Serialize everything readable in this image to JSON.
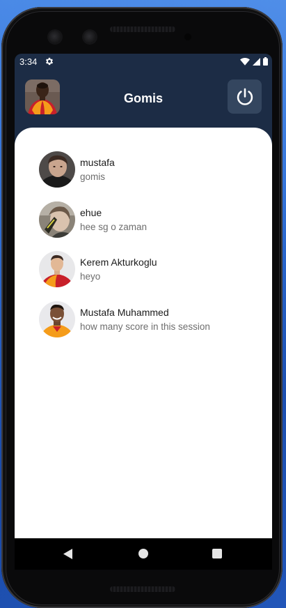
{
  "status_bar": {
    "time": "3:34",
    "icons": [
      "gear-icon",
      "wifi-icon",
      "signal-icon",
      "battery-icon"
    ]
  },
  "app_bar": {
    "title": "Gomis",
    "avatar": "profile-avatar",
    "power_icon": "power-icon"
  },
  "chats": [
    {
      "name": "mustafa",
      "last_message": "gomis"
    },
    {
      "name": "ehue",
      "last_message": "hee sg o zaman"
    },
    {
      "name": "Kerem Akturkoglu",
      "last_message": "heyo"
    },
    {
      "name": "Mustafa Muhammed",
      "last_message": "how many score in this session"
    }
  ],
  "fab": {
    "icon": "plus-icon"
  },
  "nav_bar": {
    "icons": [
      "back-icon",
      "home-icon",
      "recents-icon"
    ]
  },
  "colors": {
    "primary": "#1c2c45",
    "power_button": "#34465f",
    "card": "#ffffff",
    "secondary_text": "#6d6d6d",
    "jersey_red": "#c8202a",
    "jersey_orange": "#f59c1a"
  }
}
